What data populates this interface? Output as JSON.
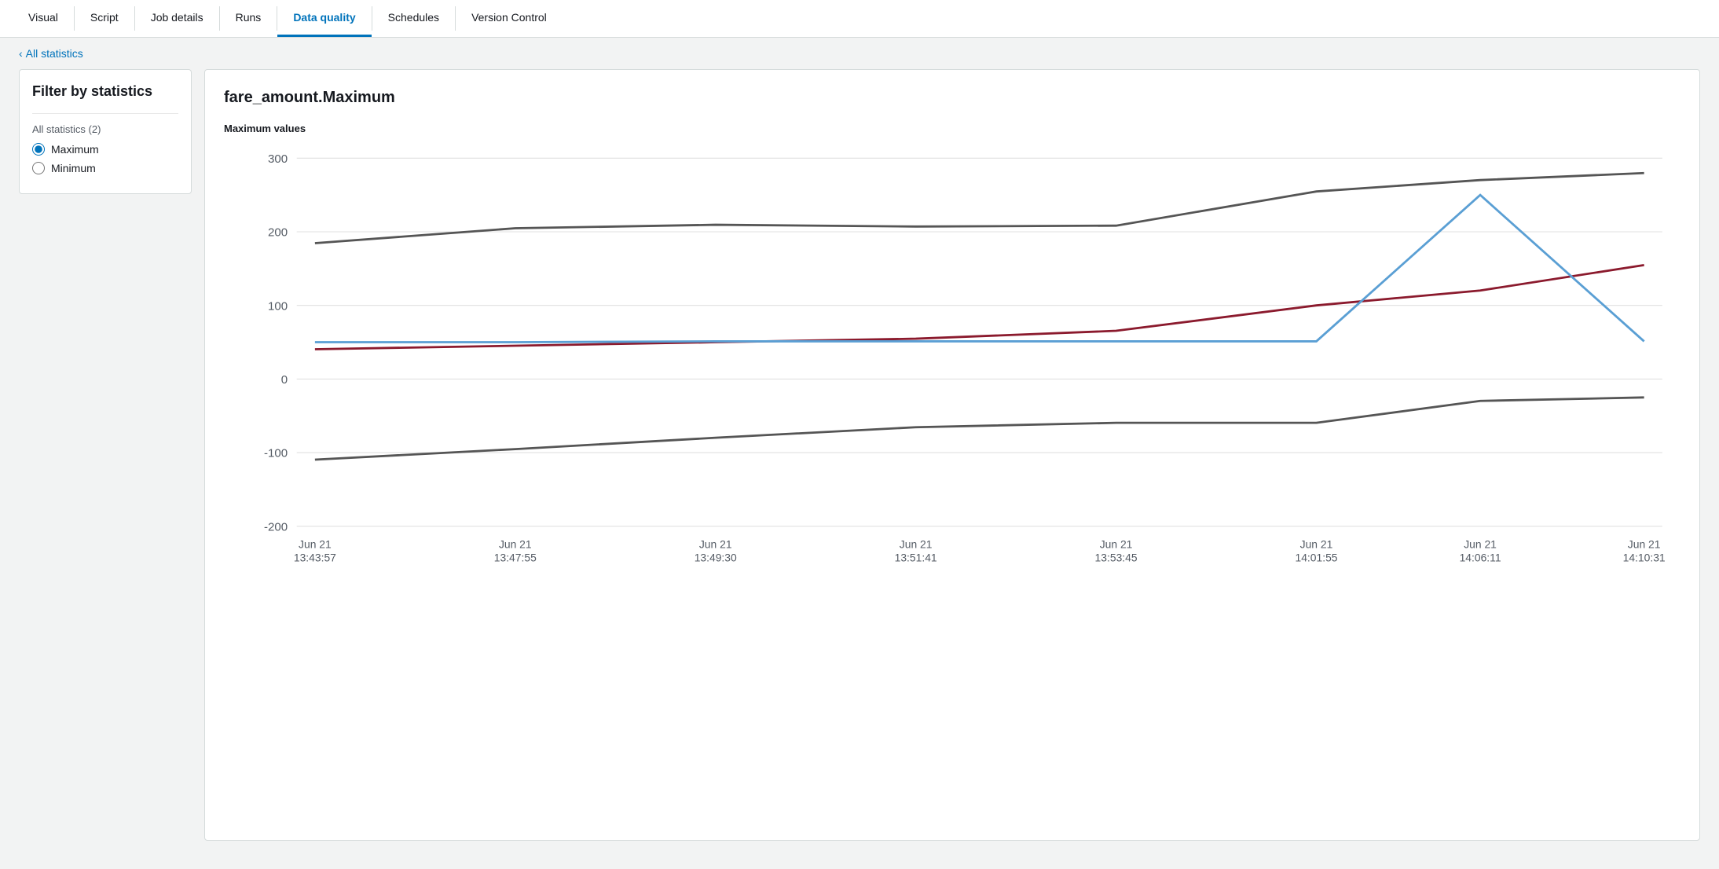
{
  "nav": {
    "tabs": [
      {
        "id": "visual",
        "label": "Visual",
        "active": false
      },
      {
        "id": "script",
        "label": "Script",
        "active": false
      },
      {
        "id": "job-details",
        "label": "Job details",
        "active": false
      },
      {
        "id": "runs",
        "label": "Runs",
        "active": false
      },
      {
        "id": "data-quality",
        "label": "Data quality",
        "active": true
      },
      {
        "id": "schedules",
        "label": "Schedules",
        "active": false
      },
      {
        "id": "version-control",
        "label": "Version Control",
        "active": false
      }
    ]
  },
  "breadcrumb": {
    "label": "All statistics",
    "chevron": "‹"
  },
  "filter": {
    "title": "Filter by statistics",
    "section_label": "All statistics (2)",
    "options": [
      {
        "id": "maximum",
        "label": "Maximum",
        "checked": true
      },
      {
        "id": "minimum",
        "label": "Minimum",
        "checked": false
      }
    ]
  },
  "chart": {
    "title": "fare_amount.Maximum",
    "subtitle": "Maximum values",
    "y_labels": [
      "300",
      "200",
      "100",
      "0",
      "-100",
      "-200"
    ],
    "x_labels": [
      {
        "line1": "Jun 21",
        "line2": "13:43:57"
      },
      {
        "line1": "Jun 21",
        "line2": "13:47:55"
      },
      {
        "line1": "Jun 21",
        "line2": "13:49:30"
      },
      {
        "line1": "Jun 21",
        "line2": "13:51:41"
      },
      {
        "line1": "Jun 21",
        "line2": "13:53:45"
      },
      {
        "line1": "Jun 21",
        "line2": "14:01:55"
      },
      {
        "line1": "Jun 21",
        "line2": "14:06:11"
      },
      {
        "line1": "Jun 21",
        "line2": "14:10:31"
      }
    ]
  }
}
